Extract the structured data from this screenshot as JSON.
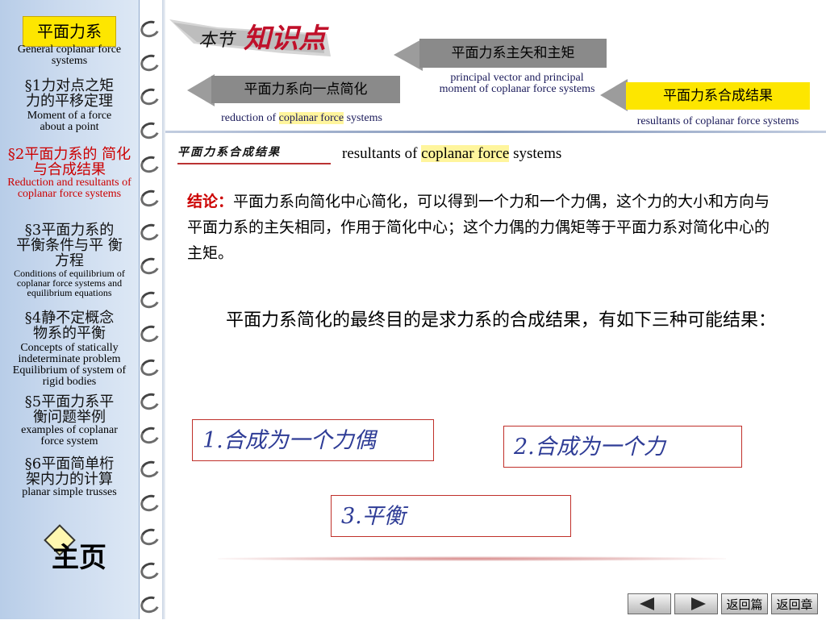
{
  "sidebar": {
    "title": "平面力系",
    "subtitle": "General coplanar force systems",
    "items": [
      {
        "cn": "§1力对点之矩 力的平移定理",
        "en": "Moment of a force about a point"
      },
      {
        "cn": "§2平面力系的 简化与合成结果",
        "en": "Reduction and resultants of coplanar force systems"
      },
      {
        "cn": "§3平面力系的 平衡条件与平 衡方程",
        "en": "Conditions of equilibrium of coplanar force systems and equilibrium equations"
      },
      {
        "cn": "§4静不定概念 物系的平衡",
        "en": "Concepts of statically indeterminate problem Equilibrium of system of rigid bodies"
      },
      {
        "cn": "§5平面力系平 衡问题举例",
        "en": "examples of coplanar force system"
      },
      {
        "cn": "§6平面简单桁 架内力的计算",
        "en": "planar simple trusses"
      }
    ],
    "home_label": "主页"
  },
  "header": {
    "banner_a": "本节",
    "banner_b": "知识点",
    "tab1": {
      "label": "平面力系向一点简化",
      "pre": "reduction of ",
      "hl": "coplanar force",
      "post": " systems"
    },
    "tab2": {
      "label": "平面力系主矢和主矩",
      "line1": "principal vector  and principal",
      "line2": "moment of coplanar force systems"
    },
    "tab3": {
      "label": "平面力系合成结果",
      "sub": "resultants of coplanar force systems"
    }
  },
  "content": {
    "topic_cn": "平面力系合成结果",
    "topic_en_pre": "resultants of ",
    "topic_en_hl": "coplanar force",
    "topic_en_post": " systems",
    "conclusion_label": "结论：",
    "conclusion_text": "平面力系向简化中心简化，可以得到一个力和一个力偶，这个力的大小和方向与平面力系的主矢相同，作用于简化中心；这个力偶的力偶矩等于平面力系对简化中心的主矩。",
    "paragraph": "平面力系简化的最终目的是求力系的合成结果，有如下三种可能结果：",
    "results": [
      "1.合成为一个力偶",
      "2.合成为一个力",
      "3.平衡"
    ]
  },
  "footer": {
    "back_chapter_part": "返回篇",
    "back_chapter": "返回章"
  },
  "colors": {
    "accent_red": "#cc0000",
    "tab_yellow": "#fde600",
    "tab_gray": "#8a8a8a",
    "result_text": "#2e3c96"
  }
}
